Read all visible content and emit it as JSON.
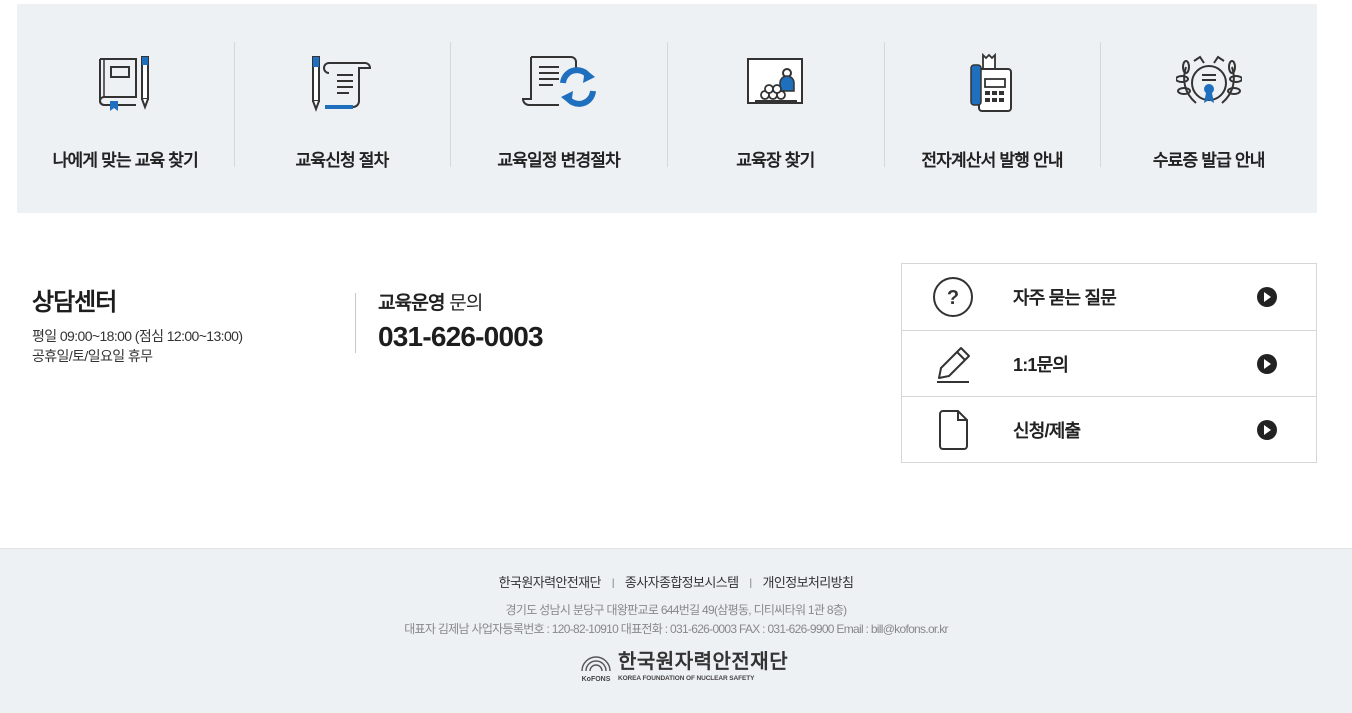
{
  "quick_menu": [
    {
      "label": "나에게 맞는 교육 찾기",
      "icon": "book-pencil-icon"
    },
    {
      "label": "교육신청 절차",
      "icon": "document-pen-icon"
    },
    {
      "label": "교육일정 변경절차",
      "icon": "schedule-change-icon"
    },
    {
      "label": "교육장 찾기",
      "icon": "classroom-icon"
    },
    {
      "label": "전자계산서 발행 안내",
      "icon": "calculator-receipt-icon"
    },
    {
      "label": "수료증 발급 안내",
      "icon": "certificate-icon"
    }
  ],
  "counsel": {
    "title": "상담센터",
    "hours_line1": "평일 09:00~18:00 (점심 12:00~13:00)",
    "hours_line2": "공휴일/토/일요일 휴무",
    "contact_label_bold": "교육운영",
    "contact_label_rest": " 문의",
    "phone": "031-626-0003"
  },
  "help_links": [
    {
      "label": "자주 묻는 질문",
      "icon": "question-circle-icon"
    },
    {
      "label": "1:1문의",
      "icon": "pencil-icon"
    },
    {
      "label": "신청/제출",
      "icon": "document-icon"
    }
  ],
  "footer": {
    "links": [
      "한국원자력안전재단",
      "종사자종합정보시스템",
      "개인정보처리방침"
    ],
    "address": "경기도 성남시 분당구 대왕판교로 644번길 49(삼평동, 디티씨타워 1관 8층)",
    "info": "대표자 김제남 사업자등록번호 : 120-82-10910 대표전화 : 031-626-0003 FAX : 031-626-9900 Email : bill@kofons.or.kr",
    "logo_mark_text": "KoFONS",
    "logo_ko": "한국원자력안전재단",
    "logo_en": "KOREA FOUNDATION OF NUCLEAR SAFETY"
  },
  "colors": {
    "accent": "#1f6fbf",
    "panel": "#eef1f4",
    "text": "#222222"
  }
}
